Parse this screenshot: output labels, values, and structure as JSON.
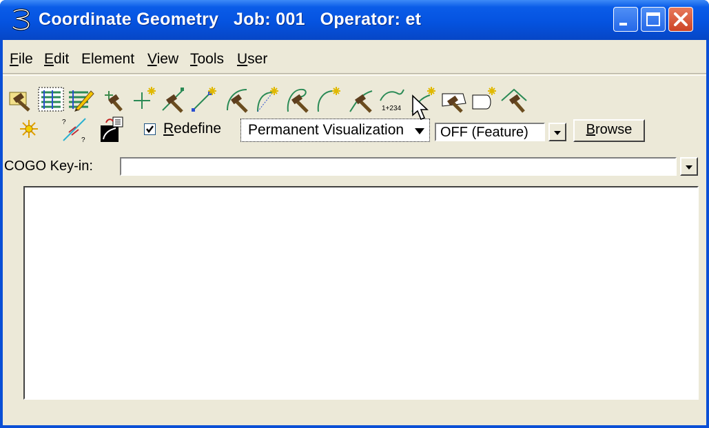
{
  "window": {
    "title": "Coordinate Geometry   Job: 001   Operator: et",
    "controls": [
      "minimize-icon",
      "maximize-icon",
      "close-icon"
    ]
  },
  "menu": {
    "items": [
      {
        "first": "F",
        "rest": "ile"
      },
      {
        "first": "E",
        "rest": "dit"
      },
      {
        "first": "",
        "rest": "Element"
      },
      {
        "first": "V",
        "rest": "iew"
      },
      {
        "first": "T",
        "rest": "ools"
      },
      {
        "first": "U",
        "rest": "ser"
      }
    ]
  },
  "toolbar": {
    "icons": [
      "store-point-icon",
      "list-table-icon",
      "edit-list-icon",
      "locate-point-icon",
      "add-point-icon",
      "line-hammer-icon",
      "line-new-icon",
      "arc-hammer-icon",
      "arc-new-icon",
      "curve-hammer-icon",
      "curve-new-icon",
      "spiral-hammer-icon",
      "station-curve-icon",
      "spiral-new-icon",
      "parcel-hammer-icon",
      "parcel-new-icon",
      "alignment-hammer-icon"
    ],
    "row2_icons": [
      "explode-icon",
      "inverse-line-icon",
      "visualization-settings-icon"
    ]
  },
  "redefine": {
    "checked": true,
    "first": "R",
    "rest": "edefine"
  },
  "visualization": {
    "selected": "Permanent Visualization"
  },
  "feature": {
    "selected": "OFF (Feature)"
  },
  "browse": {
    "first": "B",
    "rest": "rowse"
  },
  "keyin": {
    "label": "COGO Key-in:",
    "value": ""
  }
}
